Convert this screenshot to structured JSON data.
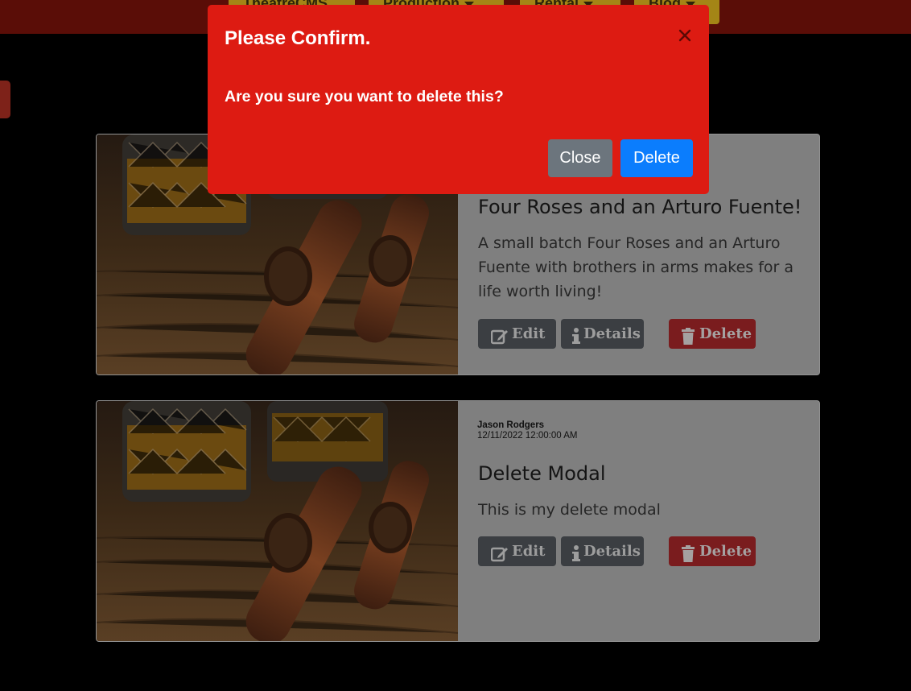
{
  "navbar": {
    "items": [
      {
        "label": "TheatreCMS",
        "has_caret": false
      },
      {
        "label": "Production",
        "has_caret": true
      },
      {
        "label": "Rental",
        "has_caret": true
      },
      {
        "label": "Blog",
        "has_caret": true
      }
    ]
  },
  "posts": [
    {
      "author": "",
      "date": "",
      "title": "Four Roses and an Arturo Fuente!",
      "text": "A small batch Four Roses and an Arturo Fuente with brothers in arms makes for a life worth living!",
      "edit_label": "Edit",
      "details_label": "Details",
      "delete_label": "Delete"
    },
    {
      "author": "Jason Rodgers",
      "date": "12/11/2022 12:00:00 AM",
      "title": "Delete Modal",
      "text": "This is my delete modal",
      "edit_label": "Edit",
      "details_label": "Details",
      "delete_label": "Delete"
    }
  ],
  "modal": {
    "title": "Please Confirm.",
    "body": "Are you sure you want to delete this?",
    "close_label": "Close",
    "delete_label": "Delete",
    "close_icon": "close-icon"
  },
  "colors": {
    "modal_bg": "#dd1b12",
    "delete_button": "#0b7dfd",
    "close_button": "#6c757d",
    "nav_bg": "#5a0d07",
    "nav_button": "#a48516"
  }
}
